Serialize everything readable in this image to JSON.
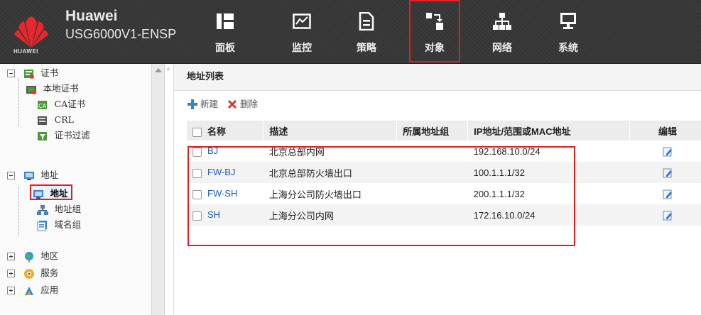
{
  "header": {
    "logo_text": "HUAWEI",
    "brand_line1": "Huawei",
    "brand_line2": "USG6000V1-ENSP",
    "nav": [
      {
        "label": "面板",
        "icon": "dashboard-icon"
      },
      {
        "label": "监控",
        "icon": "monitor-icon"
      },
      {
        "label": "策略",
        "icon": "policy-icon"
      },
      {
        "label": "对象",
        "icon": "object-icon",
        "active": true
      },
      {
        "label": "网络",
        "icon": "network-icon"
      },
      {
        "label": "系统",
        "icon": "system-icon"
      }
    ]
  },
  "sidebar": {
    "items": [
      {
        "label": "证书",
        "type": "group",
        "expanded": true,
        "icon": "certificate-icon"
      },
      {
        "label": "本地证书",
        "icon": "local-cert-icon"
      },
      {
        "label": "CA证书",
        "icon": "ca-cert-icon"
      },
      {
        "label": "CRL",
        "icon": "crl-icon"
      },
      {
        "label": "证书过滤",
        "icon": "cert-filter-icon"
      },
      {
        "label": "地址",
        "type": "group",
        "expanded": true,
        "icon": "address-icon"
      },
      {
        "label": "地址",
        "icon": "address-icon",
        "selected": true
      },
      {
        "label": "地址组",
        "icon": "address-group-icon"
      },
      {
        "label": "域名组",
        "icon": "domain-group-icon"
      },
      {
        "label": "地区",
        "type": "group",
        "expanded": false,
        "icon": "region-icon"
      },
      {
        "label": "服务",
        "type": "group",
        "expanded": false,
        "icon": "service-icon"
      },
      {
        "label": "应用",
        "type": "group",
        "expanded": false,
        "icon": "application-icon"
      }
    ]
  },
  "main": {
    "title": "地址列表",
    "toolbar": {
      "new_label": "新建",
      "delete_label": "删除"
    },
    "columns": [
      "名称",
      "描述",
      "所属地址组",
      "IP地址/范围或MAC地址",
      "编辑"
    ],
    "rows": [
      {
        "name": "BJ",
        "desc": "北京总部内网",
        "group": "",
        "ip": "192.168.10.0/24"
      },
      {
        "name": "FW-BJ",
        "desc": "北京总部防火墙出口",
        "group": "",
        "ip": "100.1.1.1/32"
      },
      {
        "name": "FW-SH",
        "desc": "上海分公司防火墙出口",
        "group": "",
        "ip": "200.1.1.1/32"
      },
      {
        "name": "SH",
        "desc": "上海分公司内网",
        "group": "",
        "ip": "172.16.10.0/24"
      }
    ]
  },
  "colors": {
    "accent_red": "#e02020",
    "link_blue": "#1a5fb4",
    "header_bg": "#3a3a3a"
  }
}
